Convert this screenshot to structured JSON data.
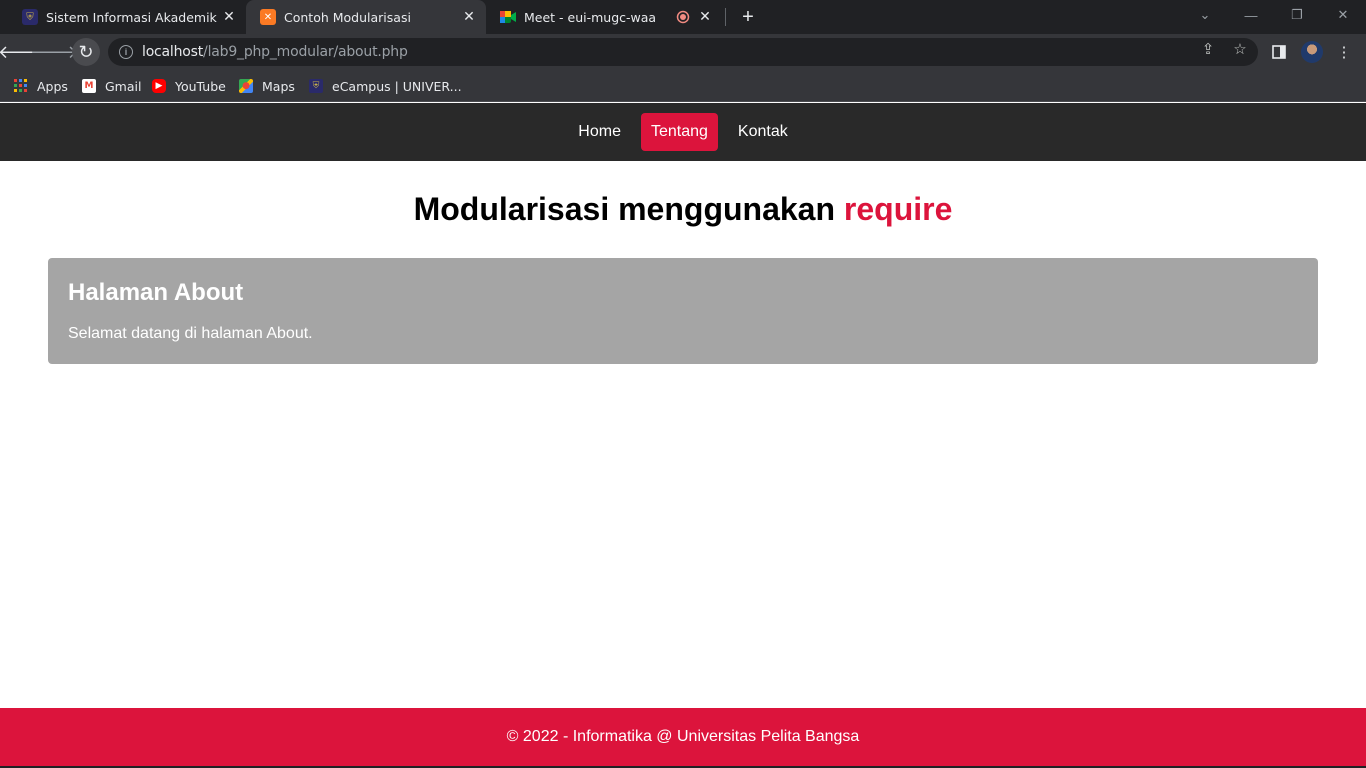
{
  "browser": {
    "tabs": [
      {
        "title": "Sistem Informasi Akademik",
        "icon": "university-logo-icon"
      },
      {
        "title": "Contoh Modularisasi",
        "icon": "xampp-icon",
        "active": true
      },
      {
        "title": "Meet - eui-mugc-waa",
        "icon": "google-meet-icon",
        "recording": true
      }
    ],
    "new_tab_label": "+",
    "url": {
      "host": "localhost",
      "path": "/lab9_php_modular/about.php"
    },
    "bookmarks": [
      {
        "label": "Apps",
        "icon": "apps-grid-icon"
      },
      {
        "label": "Gmail",
        "icon": "gmail-icon"
      },
      {
        "label": "YouTube",
        "icon": "youtube-icon"
      },
      {
        "label": "Maps",
        "icon": "maps-icon"
      },
      {
        "label": "eCampus | UNIVER...",
        "icon": "university-logo-icon"
      }
    ]
  },
  "site": {
    "nav": [
      {
        "label": "Home",
        "active": false
      },
      {
        "label": "Tentang",
        "active": true
      },
      {
        "label": "Kontak",
        "active": false
      }
    ],
    "heading": {
      "text": "Modularisasi menggunakan",
      "accent": "require"
    },
    "card": {
      "title": "Halaman About",
      "body": "Selamat datang di halaman About."
    },
    "footer": "© 2022 - Informatika @ Universitas Pelita Bangsa"
  },
  "colors": {
    "accent": "#dc143c",
    "nav_bg": "#292929",
    "card_bg": "#a5a5a5"
  }
}
